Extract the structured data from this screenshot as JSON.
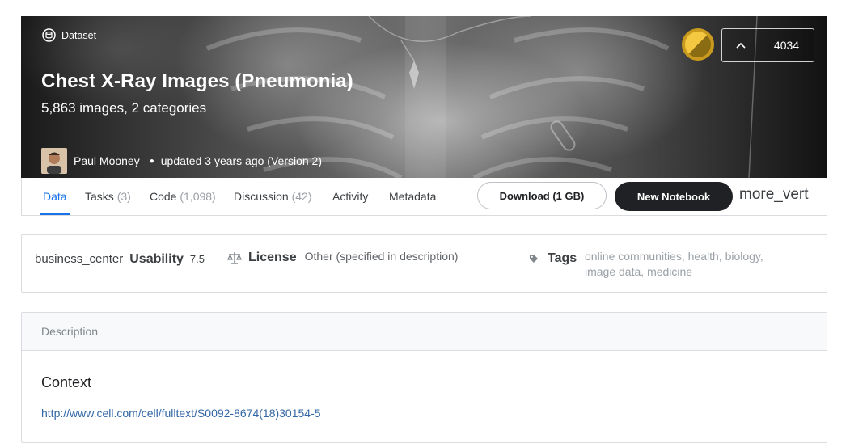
{
  "header": {
    "type_label": "Dataset",
    "title": "Chest X-Ray Images (Pneumonia)",
    "subtitle": "5,863 images, 2 categories",
    "author": "Paul Mooney",
    "updated": "updated 3 years ago (Version 2)",
    "upvotes": "4034",
    "medal_color": "#f5c842"
  },
  "tabs": [
    {
      "label": "Data",
      "count": "",
      "active": true
    },
    {
      "label": "Tasks",
      "count": "(3)",
      "active": false
    },
    {
      "label": "Code",
      "count": "(1,098)",
      "active": false
    },
    {
      "label": "Discussion",
      "count": "(42)",
      "active": false
    },
    {
      "label": "Activity",
      "count": "",
      "active": false
    },
    {
      "label": "Metadata",
      "count": "",
      "active": false
    }
  ],
  "actions": {
    "download_label": "Download (1 GB)",
    "notebook_label": "New Notebook",
    "more_label": "more_vert"
  },
  "meta": {
    "usability_icon_text": "business_center",
    "usability_label": "Usability",
    "usability_value": "7.5",
    "license_label": "License",
    "license_value": "Other (specified in description)",
    "tags_label": "Tags",
    "tags_line1": [
      {
        "text": "online communities",
        "sep": ", "
      },
      {
        "text": "health",
        "sep": ", "
      },
      {
        "text": "biology",
        "sep": ","
      }
    ],
    "tags_line2": [
      {
        "text": "image data",
        "sep": ", "
      },
      {
        "text": "medicine",
        "sep": ""
      }
    ]
  },
  "description": {
    "header": "Description",
    "heading": "Context",
    "link": "http://www.cell.com/cell/fulltext/S0092-8674(18)30154-5"
  },
  "colors": {
    "accent": "#1a73e8",
    "primary_button": "#202124"
  }
}
